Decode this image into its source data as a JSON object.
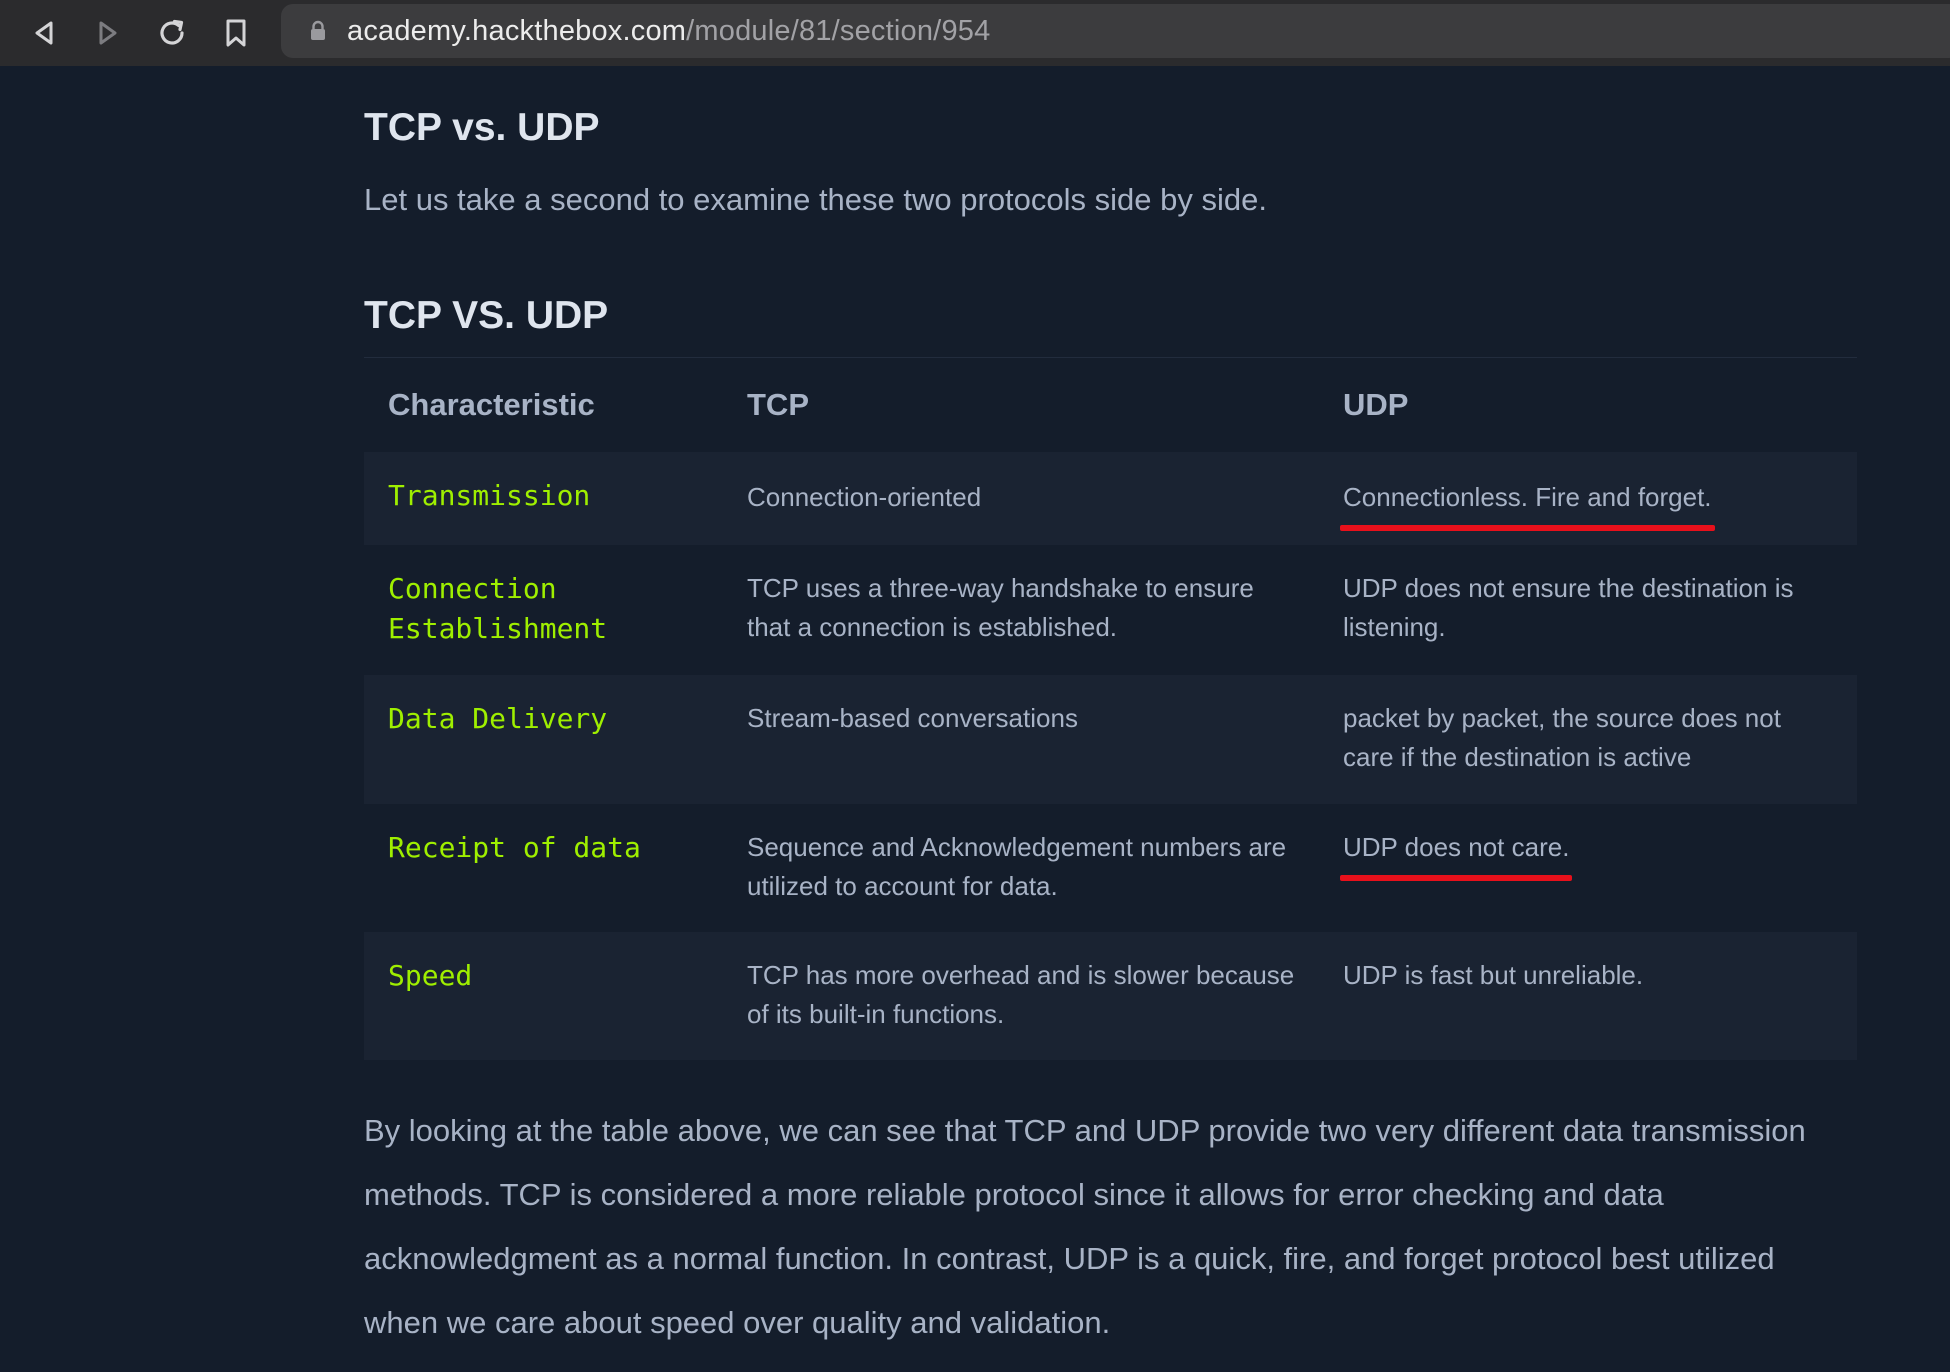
{
  "browser": {
    "url_host": "academy.hackthebox.com",
    "url_path": "/module/81/section/954",
    "icons": [
      "back-icon",
      "forward-icon",
      "reload-icon",
      "bookmark-icon",
      "lock-icon"
    ]
  },
  "page": {
    "heading": "TCP vs. UDP",
    "intro": "Let us take a second to examine these two protocols side by side.",
    "table_title": "TCP VS. UDP",
    "table": {
      "headers": [
        "Characteristic",
        "TCP",
        "UDP"
      ],
      "rows": [
        {
          "characteristic": "Transmission",
          "tcp": "Connection-oriented",
          "udp": "Connectionless. Fire and forget.",
          "udp_underlined": true
        },
        {
          "characteristic": "Connection Establishment",
          "tcp": "TCP uses a three-way handshake to ensure that a connection is established.",
          "udp": "UDP does not ensure the destination is listening.",
          "udp_underlined": false
        },
        {
          "characteristic": "Data Delivery",
          "tcp": "Stream-based conversations",
          "udp": "packet by packet, the source does not care if the destination is active",
          "udp_underlined": false
        },
        {
          "characteristic": "Receipt of data",
          "tcp": "Sequence and Acknowledgement numbers are utilized to account for data.",
          "udp": "UDP does not care.",
          "udp_underlined": true
        },
        {
          "characteristic": "Speed",
          "tcp": "TCP has more overhead and is slower because of its built-in functions.",
          "udp": "UDP is fast but unreliable.",
          "udp_underlined": false
        }
      ]
    },
    "conclusion": "By looking at the table above, we can see that TCP and UDP provide two very different data transmission methods. TCP is considered a more reliable protocol since it allows for error checking and data acknowledgment as a normal function. In contrast, UDP is a quick, fire, and forget protocol best utilized when we care about speed over quality and validation."
  },
  "colors": {
    "page_bg": "#141d2b",
    "row_alt_bg": "#1a2332",
    "characteristic_green": "#9fef00",
    "text": "#a8b3c6",
    "annotation_red": "#e8101b"
  }
}
